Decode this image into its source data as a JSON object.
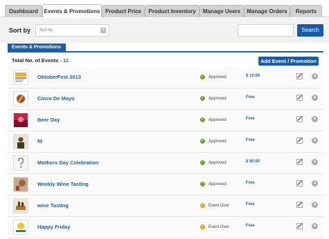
{
  "tabs": [
    {
      "label": "Dashboard"
    },
    {
      "label": "Events & Promotions"
    },
    {
      "label": "Product Price"
    },
    {
      "label": "Product Inventory"
    },
    {
      "label": "Manage Users"
    },
    {
      "label": "Manage Orders"
    },
    {
      "label": "Reports"
    }
  ],
  "sort": {
    "label": "Sort by",
    "select_placeholder": "Sort by"
  },
  "search": {
    "button_label": "Search"
  },
  "panel": {
    "tab_label": "Events & Promotions",
    "total_label": "Total No. of Events - ",
    "total_count": "11",
    "add_button": "Add Event / Promotion"
  },
  "events": [
    {
      "name": "OktoberFest 2013",
      "status": "Approved",
      "status_type": "ok",
      "price": "$ 10.00"
    },
    {
      "name": "Cinco De Mayo",
      "status": "Approved",
      "status_type": "ok",
      "price": "Free"
    },
    {
      "name": "Beer Day",
      "status": "Approved",
      "status_type": "ok",
      "price": "Free"
    },
    {
      "name": "fd",
      "status": "Approved",
      "status_type": "ok",
      "price": "Free"
    },
    {
      "name": "Mothers Day Celebration",
      "status": "Approved",
      "status_type": "ok",
      "price": "$ 50.00"
    },
    {
      "name": "Weekly Wine Tasting",
      "status": "Approved",
      "status_type": "ok",
      "price": "Free"
    },
    {
      "name": "wine Tasting",
      "status": "Event Over",
      "status_type": "over",
      "price": "Free"
    },
    {
      "name": "Happy Friday",
      "status": "Event Over",
      "status_type": "over",
      "price": "Free"
    }
  ],
  "colors": {
    "accent": "#1b5bab",
    "approved": "#6aa728",
    "event_over": "#e8a317"
  }
}
